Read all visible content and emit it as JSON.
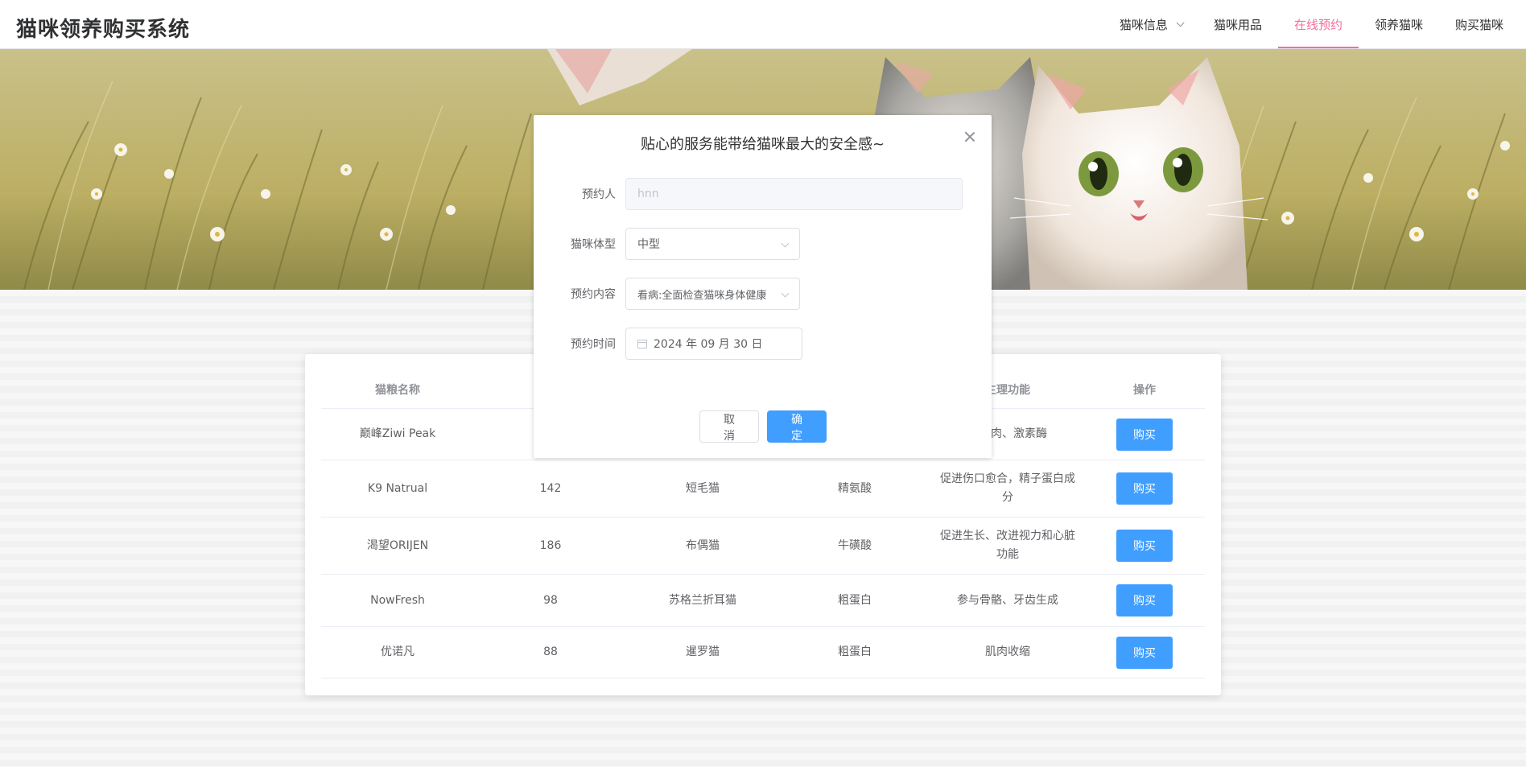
{
  "app": {
    "title": "猫咪领养购买系统"
  },
  "nav": {
    "items": [
      {
        "label": "猫咪信息",
        "has_dropdown": true,
        "active": false
      },
      {
        "label": "猫咪用品",
        "active": false
      },
      {
        "label": "在线预约",
        "active": true
      },
      {
        "label": "领养猫咪",
        "active": false
      },
      {
        "label": "购买猫咪",
        "active": false
      }
    ],
    "active_color": "#f56c9d"
  },
  "dialog": {
    "title": "贴心的服务能带给猫咪最大的安全感~",
    "fields": {
      "reserver": {
        "label": "预约人",
        "value": "hnn"
      },
      "size": {
        "label": "猫咪体型",
        "value": "中型"
      },
      "content": {
        "label": "预约内容",
        "value": "看病:全面检查猫咪身体健康"
      },
      "time": {
        "label": "预约时间",
        "value": "2024 年 09 月 30 日"
      }
    },
    "cancel_label": "取 消",
    "ok_label": "确 定"
  },
  "table": {
    "headers": [
      "猫粮名称",
      "",
      "",
      "",
      "生理功能",
      "操作"
    ],
    "rows": [
      {
        "name": "巅峰Ziwi Peak",
        "price": "",
        "breed": "",
        "nutrient": "",
        "function": "、肌肉、激素酶",
        "action": "购买"
      },
      {
        "name": "K9 Natrual",
        "price": "142",
        "breed": "短毛猫",
        "nutrient": "精氨酸",
        "function": "促进伤口愈合，精子蛋白成分",
        "action": "购买"
      },
      {
        "name": "渴望ORIJEN",
        "price": "186",
        "breed": "布偶猫",
        "nutrient": "牛磺酸",
        "function": "促进生长、改进视力和心脏功能",
        "action": "购买"
      },
      {
        "name": "NowFresh",
        "price": "98",
        "breed": "苏格兰折耳猫",
        "nutrient": "粗蛋白",
        "function": "参与骨骼、牙齿生成",
        "action": "购买"
      },
      {
        "name": "优诺凡",
        "price": "88",
        "breed": "暹罗猫",
        "nutrient": "粗蛋白",
        "function": "肌肉收缩",
        "action": "购买"
      }
    ]
  },
  "colors": {
    "primary": "#409eff",
    "accent": "#f56c9d"
  }
}
